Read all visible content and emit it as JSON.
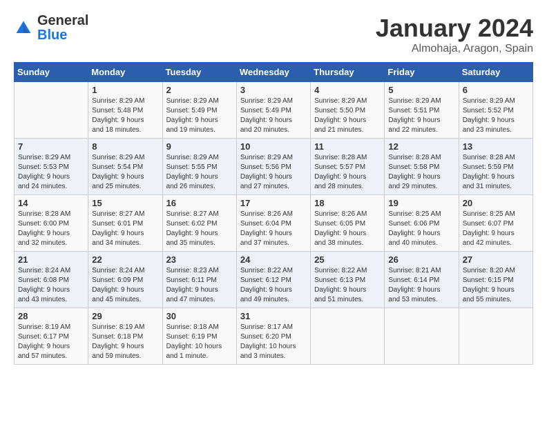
{
  "logo": {
    "general": "General",
    "blue": "Blue"
  },
  "header": {
    "title": "January 2024",
    "subtitle": "Almohaja, Aragon, Spain"
  },
  "days_of_week": [
    "Sunday",
    "Monday",
    "Tuesday",
    "Wednesday",
    "Thursday",
    "Friday",
    "Saturday"
  ],
  "weeks": [
    [
      {
        "day": "",
        "info": ""
      },
      {
        "day": "1",
        "info": "Sunrise: 8:29 AM\nSunset: 5:48 PM\nDaylight: 9 hours\nand 18 minutes."
      },
      {
        "day": "2",
        "info": "Sunrise: 8:29 AM\nSunset: 5:49 PM\nDaylight: 9 hours\nand 19 minutes."
      },
      {
        "day": "3",
        "info": "Sunrise: 8:29 AM\nSunset: 5:49 PM\nDaylight: 9 hours\nand 20 minutes."
      },
      {
        "day": "4",
        "info": "Sunrise: 8:29 AM\nSunset: 5:50 PM\nDaylight: 9 hours\nand 21 minutes."
      },
      {
        "day": "5",
        "info": "Sunrise: 8:29 AM\nSunset: 5:51 PM\nDaylight: 9 hours\nand 22 minutes."
      },
      {
        "day": "6",
        "info": "Sunrise: 8:29 AM\nSunset: 5:52 PM\nDaylight: 9 hours\nand 23 minutes."
      }
    ],
    [
      {
        "day": "7",
        "info": "Sunrise: 8:29 AM\nSunset: 5:53 PM\nDaylight: 9 hours\nand 24 minutes."
      },
      {
        "day": "8",
        "info": "Sunrise: 8:29 AM\nSunset: 5:54 PM\nDaylight: 9 hours\nand 25 minutes."
      },
      {
        "day": "9",
        "info": "Sunrise: 8:29 AM\nSunset: 5:55 PM\nDaylight: 9 hours\nand 26 minutes."
      },
      {
        "day": "10",
        "info": "Sunrise: 8:29 AM\nSunset: 5:56 PM\nDaylight: 9 hours\nand 27 minutes."
      },
      {
        "day": "11",
        "info": "Sunrise: 8:28 AM\nSunset: 5:57 PM\nDaylight: 9 hours\nand 28 minutes."
      },
      {
        "day": "12",
        "info": "Sunrise: 8:28 AM\nSunset: 5:58 PM\nDaylight: 9 hours\nand 29 minutes."
      },
      {
        "day": "13",
        "info": "Sunrise: 8:28 AM\nSunset: 5:59 PM\nDaylight: 9 hours\nand 31 minutes."
      }
    ],
    [
      {
        "day": "14",
        "info": "Sunrise: 8:28 AM\nSunset: 6:00 PM\nDaylight: 9 hours\nand 32 minutes."
      },
      {
        "day": "15",
        "info": "Sunrise: 8:27 AM\nSunset: 6:01 PM\nDaylight: 9 hours\nand 34 minutes."
      },
      {
        "day": "16",
        "info": "Sunrise: 8:27 AM\nSunset: 6:02 PM\nDaylight: 9 hours\nand 35 minutes."
      },
      {
        "day": "17",
        "info": "Sunrise: 8:26 AM\nSunset: 6:04 PM\nDaylight: 9 hours\nand 37 minutes."
      },
      {
        "day": "18",
        "info": "Sunrise: 8:26 AM\nSunset: 6:05 PM\nDaylight: 9 hours\nand 38 minutes."
      },
      {
        "day": "19",
        "info": "Sunrise: 8:25 AM\nSunset: 6:06 PM\nDaylight: 9 hours\nand 40 minutes."
      },
      {
        "day": "20",
        "info": "Sunrise: 8:25 AM\nSunset: 6:07 PM\nDaylight: 9 hours\nand 42 minutes."
      }
    ],
    [
      {
        "day": "21",
        "info": "Sunrise: 8:24 AM\nSunset: 6:08 PM\nDaylight: 9 hours\nand 43 minutes."
      },
      {
        "day": "22",
        "info": "Sunrise: 8:24 AM\nSunset: 6:09 PM\nDaylight: 9 hours\nand 45 minutes."
      },
      {
        "day": "23",
        "info": "Sunrise: 8:23 AM\nSunset: 6:11 PM\nDaylight: 9 hours\nand 47 minutes."
      },
      {
        "day": "24",
        "info": "Sunrise: 8:22 AM\nSunset: 6:12 PM\nDaylight: 9 hours\nand 49 minutes."
      },
      {
        "day": "25",
        "info": "Sunrise: 8:22 AM\nSunset: 6:13 PM\nDaylight: 9 hours\nand 51 minutes."
      },
      {
        "day": "26",
        "info": "Sunrise: 8:21 AM\nSunset: 6:14 PM\nDaylight: 9 hours\nand 53 minutes."
      },
      {
        "day": "27",
        "info": "Sunrise: 8:20 AM\nSunset: 6:15 PM\nDaylight: 9 hours\nand 55 minutes."
      }
    ],
    [
      {
        "day": "28",
        "info": "Sunrise: 8:19 AM\nSunset: 6:17 PM\nDaylight: 9 hours\nand 57 minutes."
      },
      {
        "day": "29",
        "info": "Sunrise: 8:19 AM\nSunset: 6:18 PM\nDaylight: 9 hours\nand 59 minutes."
      },
      {
        "day": "30",
        "info": "Sunrise: 8:18 AM\nSunset: 6:19 PM\nDaylight: 10 hours\nand 1 minute."
      },
      {
        "day": "31",
        "info": "Sunrise: 8:17 AM\nSunset: 6:20 PM\nDaylight: 10 hours\nand 3 minutes."
      },
      {
        "day": "",
        "info": ""
      },
      {
        "day": "",
        "info": ""
      },
      {
        "day": "",
        "info": ""
      }
    ]
  ]
}
